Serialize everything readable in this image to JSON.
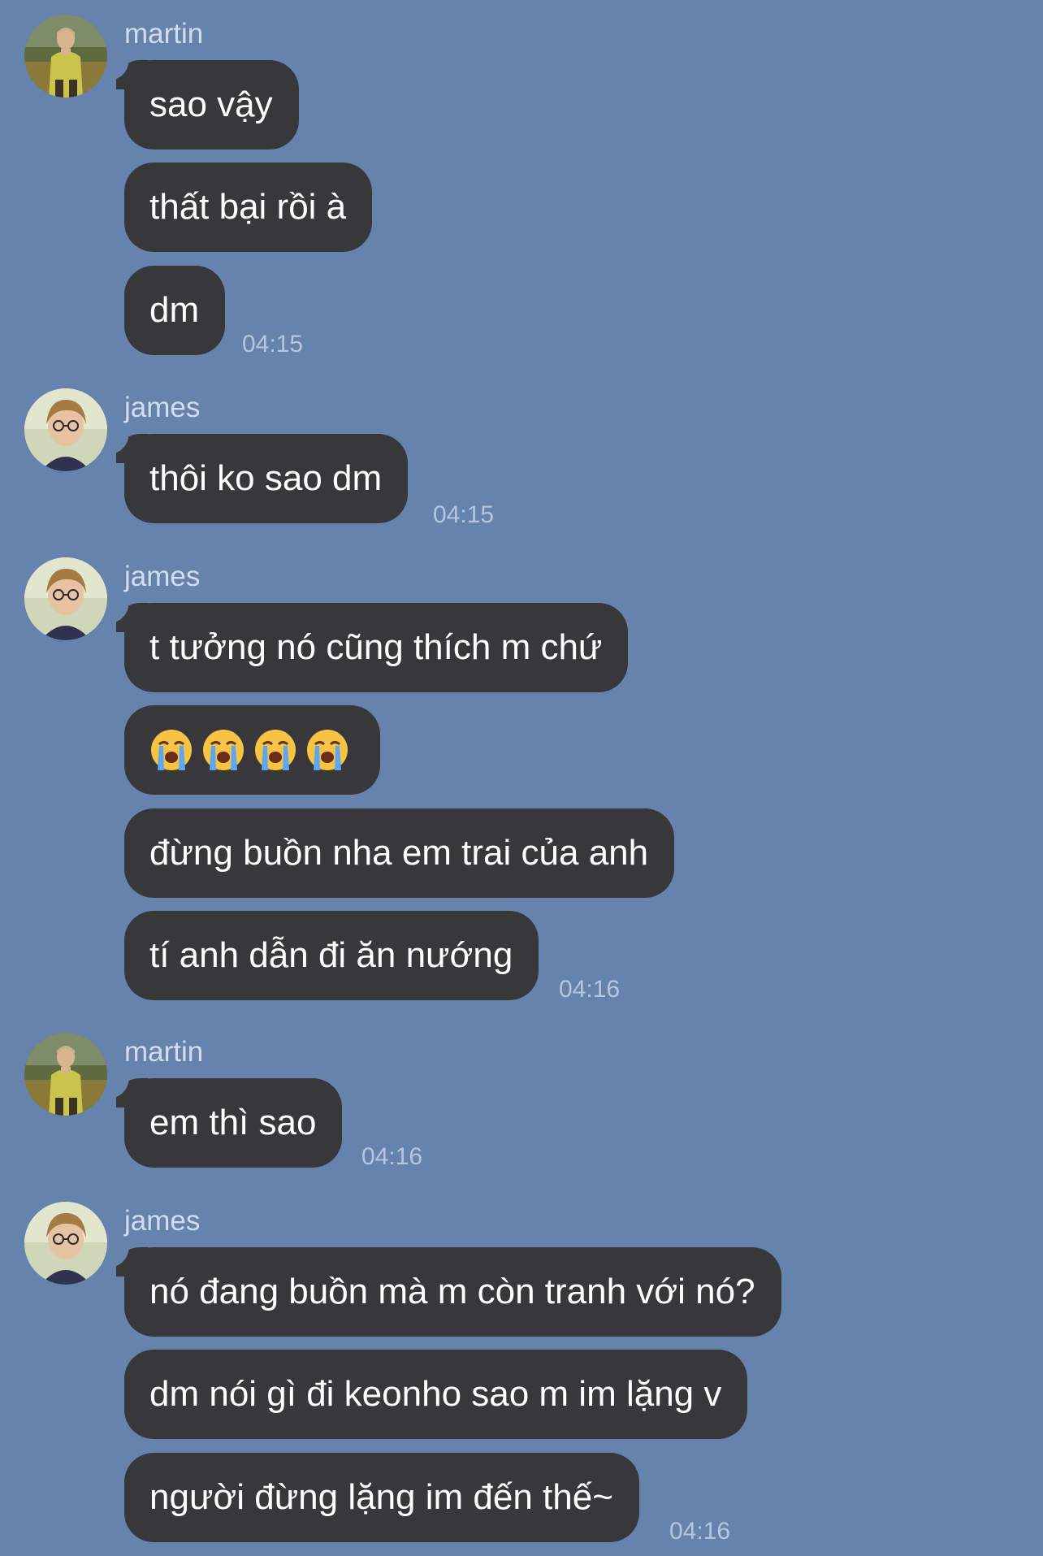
{
  "chat": {
    "groups": [
      {
        "sender": "martin",
        "avatar": "martin-avatar",
        "messages": [
          "sao vậy",
          "thất bại rồi à",
          "dm"
        ],
        "time": "04:15"
      },
      {
        "sender": "james",
        "avatar": "james-avatar",
        "messages": [
          "thôi ko sao dm"
        ],
        "time": "04:15"
      },
      {
        "sender": "james",
        "avatar": "james-avatar",
        "messages": [
          "t tưởng nó cũng thích m chứ",
          "😭😭😭😭",
          "đừng buồn nha em trai của anh",
          "tí anh dẫn đi ăn nướng"
        ],
        "time": "04:16"
      },
      {
        "sender": "martin",
        "avatar": "martin-avatar",
        "messages": [
          "em thì sao"
        ],
        "time": "04:16"
      },
      {
        "sender": "james",
        "avatar": "james-avatar",
        "messages": [
          "nó đang buồn mà m còn tranh với nó?",
          "dm nói gì đi keonho sao m im lặng v",
          "người đừng lặng im đến thế~"
        ],
        "time": "04:16"
      }
    ]
  },
  "colors": {
    "background": "#6683ad",
    "bubble": "#38383b",
    "sender_name": "#d2ddec",
    "timestamp": "#b7c6dc",
    "message_text": "#ffffff"
  },
  "emoji_icon": "loudly-crying-face-icon"
}
